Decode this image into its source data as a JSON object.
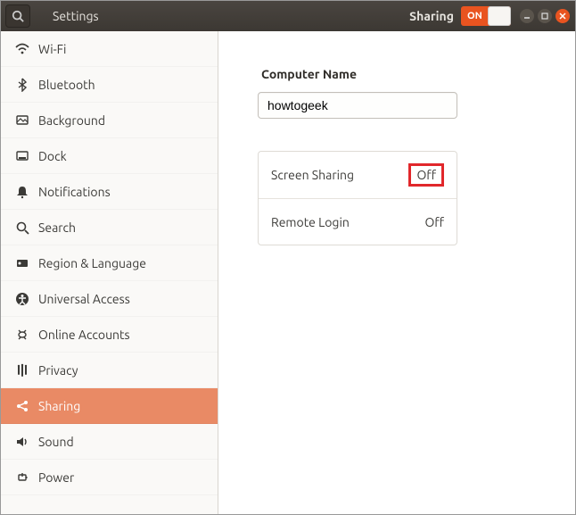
{
  "header": {
    "app_title": "Settings",
    "panel_title": "Sharing",
    "toggle_label": "ON"
  },
  "sidebar": {
    "items": [
      {
        "icon": "wifi-icon",
        "label": "Wi-Fi"
      },
      {
        "icon": "bluetooth-icon",
        "label": "Bluetooth"
      },
      {
        "icon": "background-icon",
        "label": "Background"
      },
      {
        "icon": "dock-icon",
        "label": "Dock"
      },
      {
        "icon": "notifications-icon",
        "label": "Notifications"
      },
      {
        "icon": "search-icon",
        "label": "Search"
      },
      {
        "icon": "region-icon",
        "label": "Region & Language"
      },
      {
        "icon": "universal-access-icon",
        "label": "Universal Access"
      },
      {
        "icon": "online-accounts-icon",
        "label": "Online Accounts"
      },
      {
        "icon": "privacy-icon",
        "label": "Privacy"
      },
      {
        "icon": "sharing-icon",
        "label": "Sharing"
      },
      {
        "icon": "sound-icon",
        "label": "Sound"
      },
      {
        "icon": "power-icon",
        "label": "Power"
      }
    ]
  },
  "main": {
    "computer_name_label": "Computer Name",
    "computer_name_value": "howtogeek",
    "rows": [
      {
        "label": "Screen Sharing",
        "status": "Off",
        "highlighted": true
      },
      {
        "label": "Remote Login",
        "status": "Off",
        "highlighted": false
      }
    ]
  },
  "colors": {
    "accent": "#e95420"
  }
}
